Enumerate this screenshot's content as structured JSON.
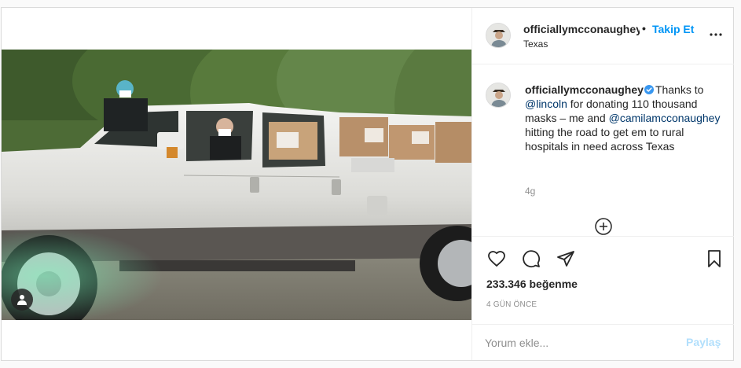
{
  "post": {
    "image_alt": "",
    "author": {
      "username": "officiallymcconaughey",
      "location": "Texas",
      "verified": true,
      "follow_label": "Takip Et",
      "separator": "•"
    },
    "caption": {
      "username": "officiallymcconaughey",
      "parts": [
        {
          "type": "text",
          "value": "Thanks to "
        },
        {
          "type": "mention",
          "value": "@lincoln"
        },
        {
          "type": "text",
          "value": " for donating 110 thousand masks – me and "
        },
        {
          "type": "mention",
          "value": "@camilamcconaughey"
        },
        {
          "type": "text",
          "value": " hitting the road to get em to rural hospitals in need across Texas"
        }
      ],
      "time": "4g"
    },
    "likes": "233.346 beğenme",
    "date": "4 GÜN ÖNCE",
    "comment": {
      "placeholder": "Yorum ekle...",
      "share_label": "Paylaş"
    },
    "icons": {
      "more": "more-options-icon",
      "verified": "verified-badge-icon",
      "load_more": "plus-circle-icon",
      "like": "heart-icon",
      "comment": "comment-icon",
      "share": "paper-plane-icon",
      "save": "bookmark-icon",
      "tags": "user-tag-icon"
    },
    "colors": {
      "link": "#0095f6",
      "mention": "#00376b",
      "secondary_text": "#8e8e8e",
      "disabled_link": "#b2dffc",
      "border": "#dbdbdb"
    }
  }
}
